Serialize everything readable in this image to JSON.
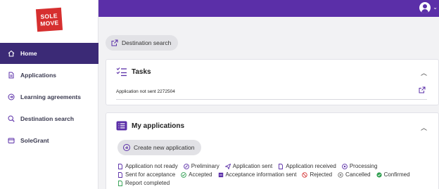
{
  "brand": {
    "logo_line1": "SOLE",
    "logo_line2": "MOVE"
  },
  "sidebar": {
    "items": [
      {
        "label": "Home",
        "icon": "home-icon",
        "active": true
      },
      {
        "label": "Applications",
        "icon": "document-icon",
        "active": false
      },
      {
        "label": "Learning agreements",
        "icon": "circle-arrow-icon",
        "active": false
      },
      {
        "label": "Destination search",
        "icon": "search-globe-icon",
        "active": false
      },
      {
        "label": "SoleGrant",
        "icon": "wallet-icon",
        "active": false
      }
    ]
  },
  "topbar": {
    "avatar_icon": "user-avatar-icon",
    "caret": "⌄"
  },
  "destination_button": {
    "label": "Destination search",
    "icon": "external-link-icon"
  },
  "tasks": {
    "title": "Tasks",
    "icon": "checklist-icon",
    "row": "Application not sent 2272504",
    "link_icon": "external-link-icon"
  },
  "applications": {
    "title": "My applications",
    "icon": "list-icon",
    "create_label": "Create new application",
    "legend": [
      {
        "label": "Application not ready",
        "icon": "document-icon",
        "color": "#5b2fa8"
      },
      {
        "label": "Preliminary",
        "icon": "pencil-circle-icon",
        "color": "#5b2fa8"
      },
      {
        "label": "Application sent",
        "icon": "paper-plane-icon",
        "color": "#5b2fa8"
      },
      {
        "label": "Application received",
        "icon": "document-icon",
        "color": "#5b2fa8"
      },
      {
        "label": "Processing",
        "icon": "gear-circle-icon",
        "color": "#5b2fa8"
      },
      {
        "label": "Sent for acceptance",
        "icon": "document-icon",
        "color": "#5b2fa8"
      },
      {
        "label": "Accepted",
        "icon": "check-circle-icon",
        "color": "#2e9e4f"
      },
      {
        "label": "Acceptance information sent",
        "icon": "inbox-icon",
        "color": "#5b2fa8"
      },
      {
        "label": "Rejected",
        "icon": "ban-icon",
        "color": "#d63a3a"
      },
      {
        "label": "Cancelled",
        "icon": "x-circle-icon",
        "color": "#777777"
      },
      {
        "label": "Confirmed",
        "icon": "check-filled-icon",
        "color": "#2e9e4f"
      },
      {
        "label": "Report completed",
        "icon": "document-icon",
        "color": "#2e9e4f"
      }
    ]
  },
  "colors": {
    "primary": "#5b2fa8",
    "sidebar_active": "#3b2a76",
    "brand_red": "#d62f2f"
  }
}
